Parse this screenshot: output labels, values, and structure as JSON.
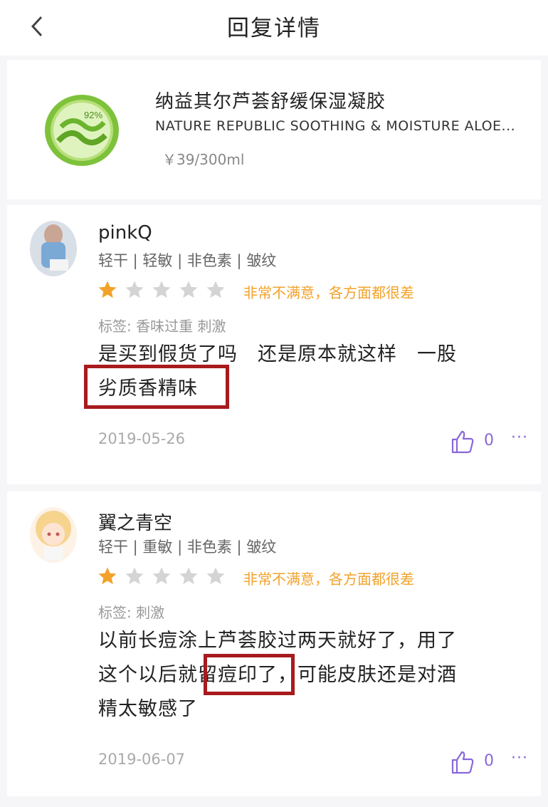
{
  "header": {
    "title": "回复详情",
    "back_icon": "chevron-left-icon"
  },
  "product": {
    "name_cn": "纳益其尔芦荟舒缓保湿凝胶",
    "name_en": "NATURE REPUBLIC SOOTHING & MOISTURE ALOE...",
    "price": "￥39/300ml",
    "jar_label": "92%"
  },
  "reviews": [
    {
      "username": "pinkQ",
      "skin": "轻干 | 轻敏 | 非色素 | 皱纹",
      "stars": 1,
      "rating_text": "非常不满意，各方面都很差",
      "tags": "标签: 香味过重  刺激",
      "text_line1": "是买到假货了吗　还是原本就这样　一股",
      "text_line2": "劣质香精味",
      "date": "2019-05-26",
      "likes": "0",
      "more": "···"
    },
    {
      "username": "翼之青空",
      "skin": "轻干 | 重敏 | 非色素 | 皱纹",
      "stars": 1,
      "rating_text": "非常不满意，各方面都很差",
      "tags": "标签: 刺激",
      "text_line1": "以前长痘涂上芦荟胶过两天就好了，用了",
      "text_line2": "这个以后就留痘印了，可能皮肤还是对酒",
      "text_line3": "精太敏感了",
      "date": "2019-06-07",
      "likes": "0",
      "more": "···"
    }
  ],
  "colors": {
    "star_on": "#f2a22a",
    "star_off": "#d4d4d4",
    "accent": "#8868d8",
    "highlight": "#a81a1e"
  }
}
